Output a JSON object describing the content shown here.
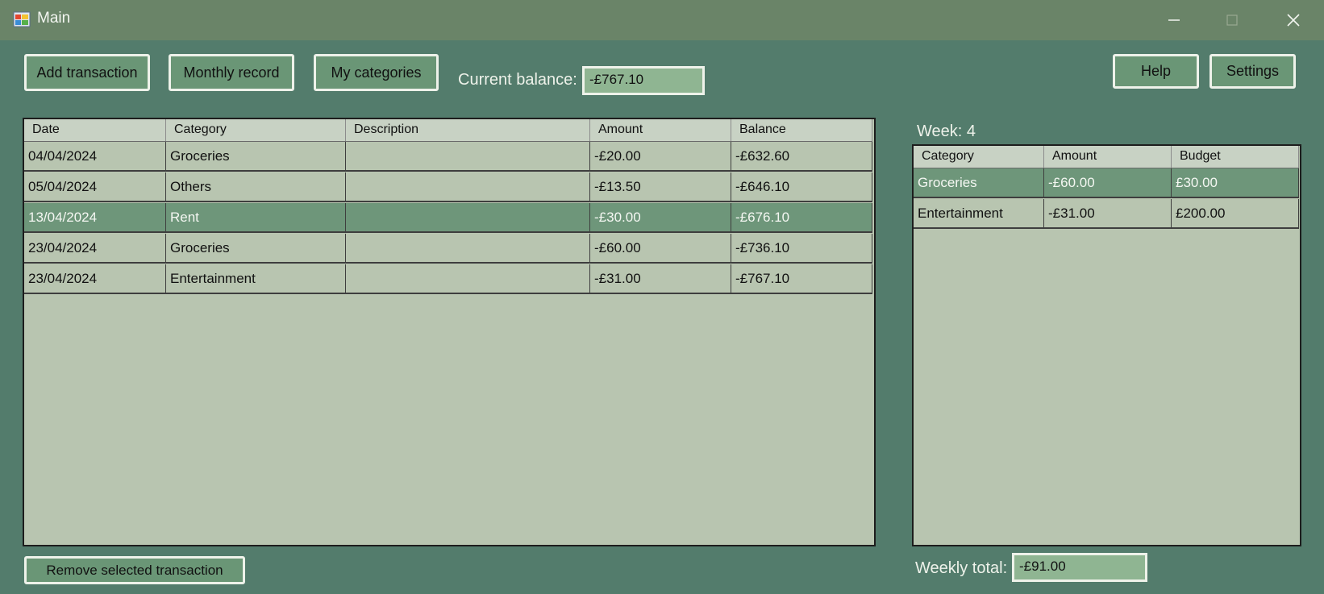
{
  "window": {
    "title": "Main"
  },
  "toolbar": {
    "add_transaction": "Add transaction",
    "monthly_record": "Monthly record",
    "my_categories": "My categories",
    "help": "Help",
    "settings": "Settings"
  },
  "balance": {
    "label": "Current balance:",
    "value": "-£767.10"
  },
  "transactions": {
    "columns": [
      "Date",
      "Category",
      "Description",
      "Amount",
      "Balance"
    ],
    "rows": [
      {
        "date": "04/04/2024",
        "category": "Groceries",
        "description": "",
        "amount": "-£20.00",
        "balance": "-£632.60",
        "selected": false
      },
      {
        "date": "05/04/2024",
        "category": "Others",
        "description": "",
        "amount": "-£13.50",
        "balance": "-£646.10",
        "selected": false
      },
      {
        "date": "13/04/2024",
        "category": "Rent",
        "description": "",
        "amount": "-£30.00",
        "balance": "-£676.10",
        "selected": true
      },
      {
        "date": "23/04/2024",
        "category": "Groceries",
        "description": "",
        "amount": "-£60.00",
        "balance": "-£736.10",
        "selected": false
      },
      {
        "date": "23/04/2024",
        "category": "Entertainment",
        "description": "",
        "amount": "-£31.00",
        "balance": "-£767.10",
        "selected": false
      }
    ]
  },
  "remove_button": "Remove selected transaction",
  "week": {
    "label": "Week: 4",
    "columns": [
      "Category",
      "Amount",
      "Budget"
    ],
    "rows": [
      {
        "category": "Groceries",
        "amount": "-£60.00",
        "budget": "£30.00",
        "selected": true
      },
      {
        "category": "Entertainment",
        "amount": "-£31.00",
        "budget": "£200.00",
        "selected": false
      }
    ],
    "total_label": "Weekly total:",
    "total_value": "-£91.00"
  },
  "colors": {
    "background": "#537c6c",
    "titlebar": "#6a8468",
    "grid_background": "#b8c5b0",
    "selection": "#6e967a",
    "field": "#8fb592"
  }
}
